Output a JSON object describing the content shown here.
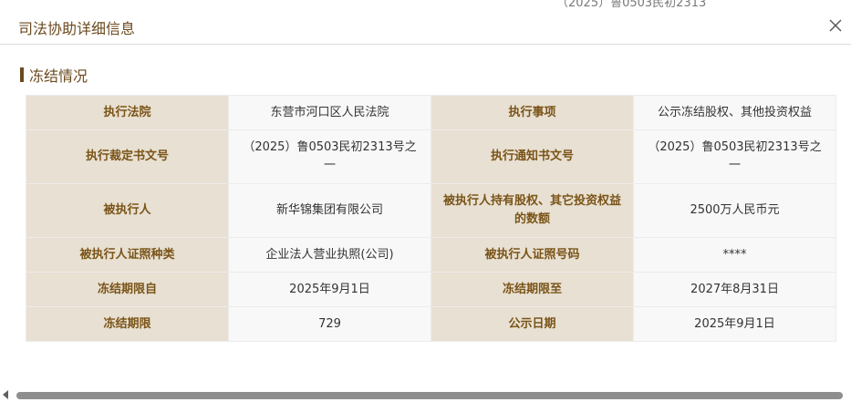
{
  "modal": {
    "title": "司法协助详细信息"
  },
  "section": {
    "title": "冻结情况"
  },
  "background_peek": {
    "text": "（2025）鲁0503民初2313"
  },
  "rows": [
    {
      "label1": "执行法院",
      "value1": "东营市河口区人民法院",
      "label2": "执行事项",
      "value2": "公示冻结股权、其他投资权益"
    },
    {
      "label1": "执行裁定书文号",
      "value1": "（2025）鲁0503民初2313号之一",
      "label2": "执行通知书文号",
      "value2": "（2025）鲁0503民初2313号之一"
    },
    {
      "label1": "被执行人",
      "value1": "新华锦集团有限公司",
      "label2": "被执行人持有股权、其它投资权益的数额",
      "value2": "2500万人民币元"
    },
    {
      "label1": "被执行人证照种类",
      "value1": "企业法人营业执照(公司)",
      "label2": "被执行人证照号码",
      "value2": "****"
    },
    {
      "label1": "冻结期限自",
      "value1": "2025年9月1日",
      "label2": "冻结期限至",
      "value2": "2027年8月31日"
    },
    {
      "label1": "冻结期限",
      "value1": "729",
      "label2": "公示日期",
      "value2": "2025年9月1日"
    }
  ],
  "icons": {
    "close": "close-icon",
    "scroll_left": "chevron-left-icon"
  },
  "colors": {
    "title": "#6b4a1f",
    "label_bg": "#e8e0d2",
    "label_text": "#7a5418",
    "value_bg": "#f8f8f8"
  }
}
